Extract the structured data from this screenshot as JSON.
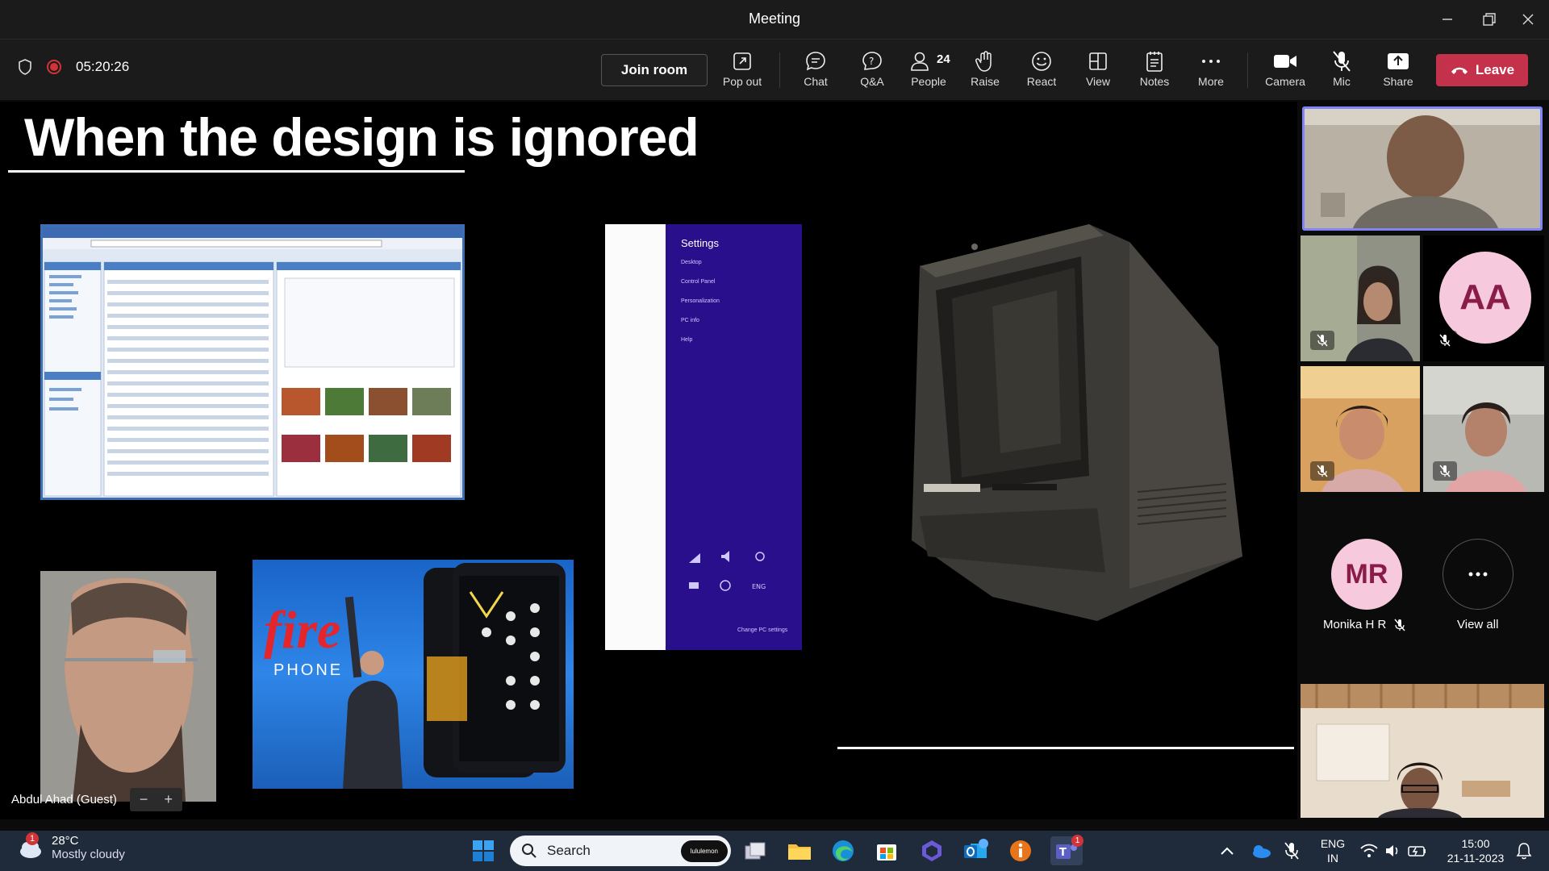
{
  "window": {
    "title": "Meeting"
  },
  "meeting": {
    "elapsed": "05:20:26"
  },
  "toolbar": {
    "join_room": "Join room",
    "pop_out": "Pop out",
    "chat": "Chat",
    "qa": "Q&A",
    "people": "People",
    "people_count": "24",
    "raise": "Raise",
    "react": "React",
    "view": "View",
    "notes": "Notes",
    "more": "More",
    "camera": "Camera",
    "mic": "Mic",
    "share": "Share",
    "leave": "Leave"
  },
  "slide": {
    "title": "When the design is ignored",
    "settings_panel": {
      "title": "Settings",
      "items": [
        "Desktop",
        "Control Panel",
        "Personalization",
        "PC info",
        "Help"
      ],
      "footer": "Change PC settings"
    },
    "fire_text": "fire",
    "phone_text": "PHONE"
  },
  "stage": {
    "presenter_name": "Abdul Ahad (Guest)",
    "zoom_out": "−",
    "zoom_in": "+"
  },
  "participants": {
    "tile_aa_initials": "AA",
    "tile_mr_initials": "MR",
    "tile_mr_name": "Monika H R",
    "view_all": "View all"
  },
  "taskbar": {
    "weather_badge": "1",
    "temperature": "28°C",
    "condition": "Mostly cloudy",
    "search_placeholder": "Search",
    "search_pill": "lululemon",
    "teams_badge": "1",
    "lang_1": "ENG",
    "lang_2": "IN",
    "time": "15:00",
    "date": "21-11-2023"
  },
  "colors": {
    "leave": "#c4314b",
    "record": "#d13438",
    "active_speaker_border": "#7f85f5",
    "avatar_bg": "#f6c9dd",
    "taskbar": "#1f2a3a"
  }
}
